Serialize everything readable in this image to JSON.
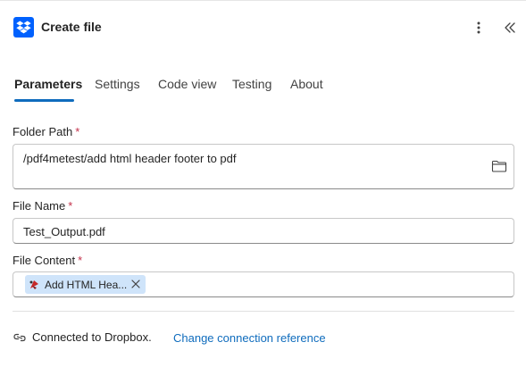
{
  "header": {
    "title": "Create file",
    "app_icon": "dropbox-icon",
    "more_icon": "more-vertical-icon",
    "collapse_icon": "chevron-double-left-icon"
  },
  "tabs": [
    {
      "label": "Parameters",
      "active": true
    },
    {
      "label": "Settings",
      "active": false
    },
    {
      "label": "Code view",
      "active": false
    },
    {
      "label": "Testing",
      "active": false
    },
    {
      "label": "About",
      "active": false
    }
  ],
  "fields": {
    "folder_path": {
      "label": "Folder Path",
      "required_marker": "*",
      "value": "/pdf4metest/add html header footer to pdf",
      "browse_icon": "folder-icon"
    },
    "file_name": {
      "label": "File Name",
      "required_marker": "*",
      "value": "Test_Output.pdf"
    },
    "file_content": {
      "label": "File Content",
      "required_marker": "*",
      "token": {
        "label": "Add HTML Hea...",
        "icon": "pdf4me-action-icon",
        "remove_icon": "close-icon"
      }
    }
  },
  "connection": {
    "icon": "link-icon",
    "status": "Connected to Dropbox.",
    "change_link": "Change connection reference"
  },
  "colors": {
    "accent": "#0f6cbd",
    "dropbox": "#0061fe",
    "token_bg": "#cfe4fa",
    "required": "#c4314b"
  }
}
